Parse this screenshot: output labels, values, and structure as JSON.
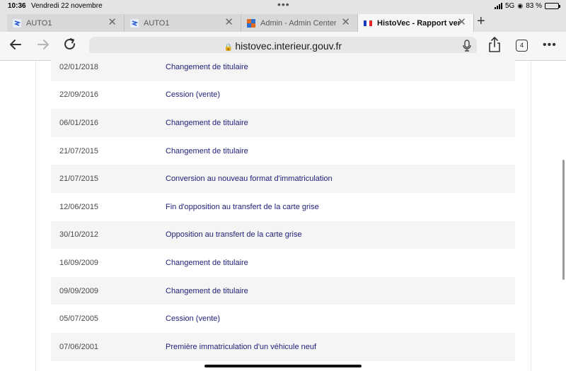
{
  "status_bar": {
    "time": "10:36",
    "date": "Vendredi 22 novembre",
    "network": "5G",
    "battery": "83 %"
  },
  "tabs": [
    {
      "title": "AUTO1"
    },
    {
      "title": "AUTO1"
    },
    {
      "title": "Admin - Admin Center"
    },
    {
      "title": "HistoVec - Rapport vende"
    }
  ],
  "toolbar": {
    "url": "histovec.interieur.gouv.fr",
    "tab_count": "4"
  },
  "history": [
    {
      "date": "02/01/2018",
      "event": "Changement de titulaire"
    },
    {
      "date": "22/09/2016",
      "event": "Cession (vente)"
    },
    {
      "date": "06/01/2016",
      "event": "Changement de titulaire"
    },
    {
      "date": "21/07/2015",
      "event": "Changement de titulaire"
    },
    {
      "date": "21/07/2015",
      "event": "Conversion au nouveau format d'immatriculation"
    },
    {
      "date": "12/06/2015",
      "event": "Fin d'opposition au transfert de la carte grise"
    },
    {
      "date": "30/10/2012",
      "event": "Opposition au transfert de la carte grise"
    },
    {
      "date": "16/09/2009",
      "event": "Changement de titulaire"
    },
    {
      "date": "09/09/2009",
      "event": "Changement de titulaire"
    },
    {
      "date": "05/07/2005",
      "event": "Cession (vente)"
    },
    {
      "date": "07/06/2001",
      "event": "Première immatriculation d'un véhicule neuf"
    }
  ],
  "colors": {
    "link": "#1e1e78",
    "row_shade": "#f5f5f5"
  }
}
